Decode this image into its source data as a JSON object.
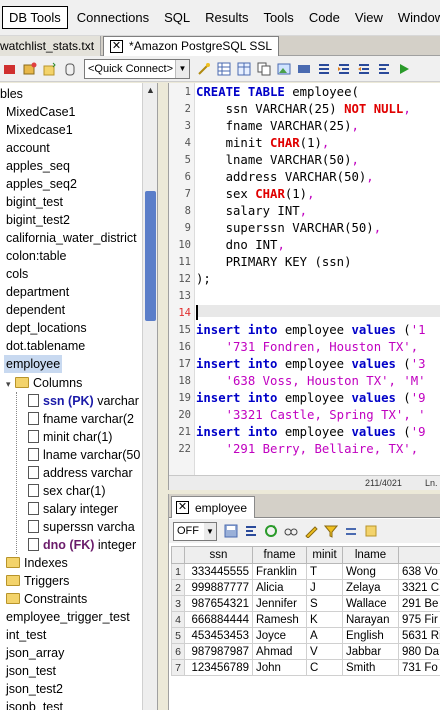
{
  "menu": {
    "items": [
      "DB Tools",
      "Connections",
      "SQL",
      "Results",
      "Tools",
      "Code",
      "View",
      "Window"
    ],
    "underline": [
      "D",
      "C",
      "Q",
      "R",
      "T",
      "o",
      "V",
      "W"
    ]
  },
  "tabs": {
    "inactive_label": "watchlist_stats.txt",
    "active_label": "*Amazon PostgreSQL SSL"
  },
  "toolbar": {
    "quick_connect": "<Quick Connect>"
  },
  "tree": {
    "top_label": "bles",
    "tables": [
      "MixedCase1",
      "Mixedcase1",
      "account",
      "apples_seq",
      "apples_seq2",
      "bigint_test",
      "bigint_test2",
      "california_water_district",
      "colon:table",
      "cols",
      "department",
      "dependent",
      "dept_locations",
      "dot.tablename",
      "employee"
    ],
    "columns_folder": "Columns",
    "columns": [
      {
        "name": "ssn",
        "badge": "(PK)",
        "type": "varchar",
        "kind": "pk"
      },
      {
        "name": "fname varchar(2",
        "kind": "normal"
      },
      {
        "name": "minit char(1)",
        "kind": "normal"
      },
      {
        "name": "lname varchar(50",
        "kind": "normal"
      },
      {
        "name": "address varchar",
        "kind": "normal"
      },
      {
        "name": "sex char(1)",
        "kind": "normal"
      },
      {
        "name": "salary integer",
        "kind": "normal"
      },
      {
        "name": "superssn varcha",
        "kind": "normal"
      },
      {
        "name": "dno",
        "badge": "(FK)",
        "type": "integer",
        "kind": "fk"
      }
    ],
    "folders": [
      "Indexes",
      "Triggers",
      "Constraints"
    ],
    "more_tables": [
      "employee_trigger_test",
      "int_test",
      "json_array",
      "json_test",
      "json_test2",
      "jsonb_test"
    ]
  },
  "editor": {
    "line_numbers": [
      "1",
      "2",
      "3",
      "4",
      "5",
      "6",
      "7",
      "8",
      "9",
      "10",
      "11",
      "12",
      "13",
      "14",
      "15",
      "16",
      "17",
      "18",
      "19",
      "20",
      "21",
      "22"
    ],
    "error_line": "14",
    "status_pos": "211/4021",
    "status_ln": "Ln."
  },
  "code": {
    "l1": [
      "CREATE TABLE",
      " employee("
    ],
    "l2": [
      "    ssn VARCHAR(25) ",
      "NOT NULL",
      ","
    ],
    "l3": [
      "    fname VARCHAR(25)",
      ","
    ],
    "l4": [
      "    minit ",
      "CHAR",
      "(1)",
      ","
    ],
    "l5": [
      "    lname VARCHAR(50)",
      ","
    ],
    "l6": [
      "    address VARCHAR(50)",
      ","
    ],
    "l7": [
      "    sex ",
      "CHAR",
      "(1)",
      ","
    ],
    "l8": [
      "    salary INT",
      ","
    ],
    "l9": [
      "    superssn VARCHAR(50)",
      ","
    ],
    "l10": [
      "    dno INT",
      ","
    ],
    "l11": [
      "    PRIMARY KEY (ssn)"
    ],
    "l12": [
      ");"
    ],
    "l15": [
      "insert into",
      " employee ",
      "values",
      " (",
      "'1"
    ],
    "l16": [
      "    ",
      "'731 Fondren, Houston TX'",
      ","
    ],
    "l17": [
      "insert into",
      " employee ",
      "values",
      " (",
      "'3"
    ],
    "l18": [
      "    ",
      "'638 Voss, Houston TX'",
      ", ",
      "'M'"
    ],
    "l19": [
      "insert into",
      " employee ",
      "values",
      " (",
      "'9"
    ],
    "l20": [
      "    ",
      "'3321 Castle, Spring TX'",
      ", ",
      "'"
    ],
    "l21": [
      "insert into",
      " employee ",
      "values",
      " (",
      "'9"
    ],
    "l22": [
      "    ",
      "'291 Berry, Bellaire, TX'",
      ","
    ]
  },
  "result": {
    "tab_label": "employee",
    "mode": "OFF",
    "columns": [
      "ssn",
      "fname",
      "minit",
      "lname",
      ""
    ],
    "rows": [
      [
        "1",
        "333445555",
        "Franklin",
        "T",
        "Wong",
        "638 Vo"
      ],
      [
        "2",
        "999887777",
        "Alicia",
        "J",
        "Zelaya",
        "3321 C"
      ],
      [
        "3",
        "987654321",
        "Jennifer",
        "S",
        "Wallace",
        "291 Be"
      ],
      [
        "4",
        "666884444",
        "Ramesh",
        "K",
        "Narayan",
        "975 Fir"
      ],
      [
        "5",
        "453453453",
        "Joyce",
        "A",
        "English",
        "5631 Ri"
      ],
      [
        "6",
        "987987987",
        "Ahmad",
        "V",
        "Jabbar",
        "980 Da"
      ],
      [
        "7",
        "123456789",
        "John",
        "C",
        "Smith",
        "731 Fo"
      ]
    ]
  },
  "colors": {
    "keyword": "#0000c8",
    "string": "#c000c0",
    "not_null": "#e00000",
    "selection": "#c8d9f0",
    "scroll_thumb": "#5b7ec9"
  }
}
